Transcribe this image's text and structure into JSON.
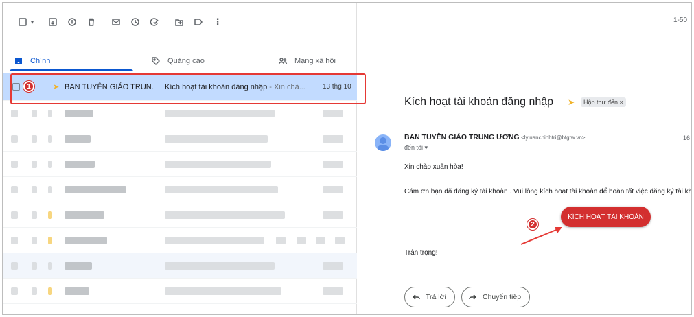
{
  "toolbar": {
    "icons": [
      "select-checkbox-icon",
      "dropdown-caret-icon",
      "archive-icon",
      "report-spam-icon",
      "delete-icon",
      "mark-unread-icon",
      "snooze-icon",
      "add-to-tasks-icon",
      "move-to-icon",
      "label-icon",
      "more-icon"
    ],
    "page_count": "1-50"
  },
  "tabs": [
    {
      "label": "Chính",
      "icon": "inbox-icon",
      "active": true
    },
    {
      "label": "Quảng cáo",
      "icon": "tag-icon",
      "active": false
    },
    {
      "label": "Mạng xã hội",
      "icon": "people-icon",
      "active": false
    }
  ],
  "selected_email": {
    "sender": "BAN TUYÊN GIÁO TRUN.",
    "subject": "Kích hoạt tài khoản đăng nhập",
    "snippet": " - Xin chà...",
    "date": "13 thg 10",
    "step_badge": "1"
  },
  "message": {
    "subject": "Kích hoạt tài khoản đăng nhập",
    "label": "Hộp thư đến ×",
    "from_name": "BAN TUYÊN GIÁO TRUNG ƯƠNG",
    "from_email": "<lyluanchinhtri@btgtw.vn>",
    "time_partial": "16",
    "to": "đến tôi ▾",
    "greeting": "Xin chào xuân hòa!",
    "body": "Cám ơn bạn đã đăng ký tài khoản . Vui lòng kích hoạt tài khoản để hoàn tất việc đăng ký tài khoản.",
    "activate_button": "KÍCH HOẠT TÀI KHOẢN",
    "step_badge": "2",
    "closing": "Trân trọng!",
    "reply_button": "Trả lời",
    "forward_button": "Chuyển tiếp"
  },
  "colors": {
    "accent": "#0b57d0",
    "highlight": "#e53935",
    "activate": "#d32f2f",
    "selected_row": "#c2dbff"
  }
}
